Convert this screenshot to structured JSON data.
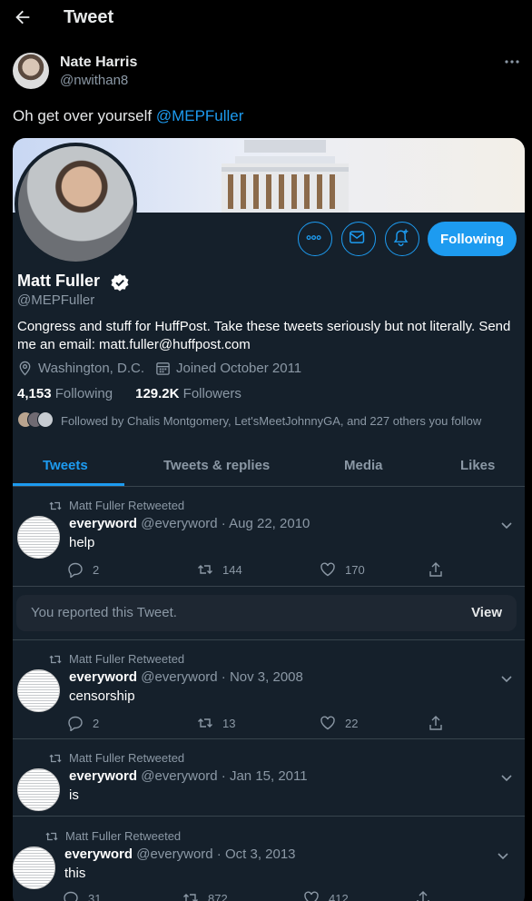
{
  "header": {
    "title": "Tweet"
  },
  "tweet": {
    "author_name": "Nate Harris",
    "author_handle": "@nwithan8",
    "text": "Oh get over yourself ",
    "mention": "@MEPFuller"
  },
  "profile": {
    "name": "Matt Fuller",
    "handle": "@MEPFuller",
    "follow_label": "Following",
    "bio": "Congress and stuff for HuffPost. Take these tweets seriously but not literally. Send me an email: matt.fuller@huffpost.com",
    "location": "Washington, D.C.",
    "joined": "Joined October 2011",
    "following_count": "4,153",
    "following_label": "Following",
    "followers_count": "129.2K",
    "followers_label": "Followers",
    "followed_by": "Followed by Chalis Montgomery, Let'sMeetJohnnyGA, and 227 others you follow"
  },
  "tabs": [
    "Tweets",
    "Tweets & replies",
    "Media",
    "Likes"
  ],
  "retweets": [
    {
      "label": "Matt Fuller Retweeted",
      "name": "everyword",
      "meta": "@everyword · Aug 22, 2010",
      "text": "help",
      "replies": "2",
      "retweets": "144",
      "likes": "170"
    },
    {
      "label": "Matt Fuller Retweeted",
      "name": "everyword",
      "meta": "@everyword · Nov 3, 2008",
      "text": "censorship",
      "replies": "2",
      "retweets": "13",
      "likes": "22"
    },
    {
      "label": "Matt Fuller Retweeted",
      "name": "everyword",
      "meta": "@everyword · Jan 15, 2011",
      "text": "is",
      "replies": "",
      "retweets": "",
      "likes": ""
    },
    {
      "label": "Matt Fuller Retweeted",
      "name": "everyword",
      "meta": "@everyword · Oct 3, 2013",
      "text": "this",
      "replies": "31",
      "retweets": "872",
      "likes": "412"
    }
  ],
  "reported": {
    "text": "You reported this Tweet.",
    "view_label": "View"
  },
  "colors": {
    "accent": "#1d9bf0",
    "card_bg": "#15202b",
    "muted": "#8b98a5"
  },
  "icons": [
    "back-arrow-icon",
    "more-icon",
    "verified-icon",
    "location-icon",
    "calendar-icon",
    "reply-icon",
    "retweet-icon",
    "like-icon",
    "share-icon",
    "chevron-down-icon",
    "bell-icon",
    "mail-icon"
  ]
}
